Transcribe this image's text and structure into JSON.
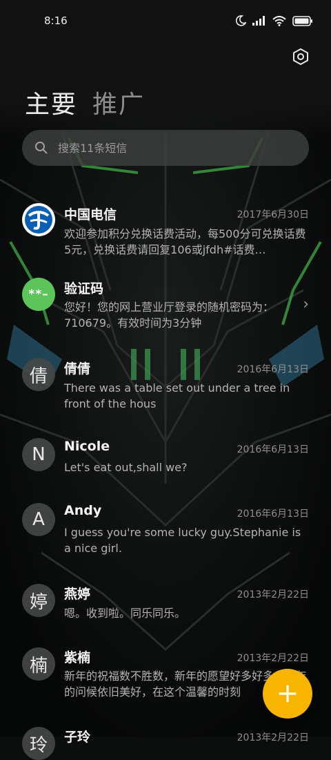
{
  "status_bar": {
    "time": "8:16"
  },
  "tabs": [
    {
      "label": "主要",
      "active": true
    },
    {
      "label": "推广",
      "active": false
    }
  ],
  "search": {
    "placeholder": "搜索11条短信"
  },
  "conversations": [
    {
      "name": "中国电信",
      "avatar_type": "telecom-logo",
      "date": "2017年6月30日",
      "preview": "欢迎参加积分兑换话费活动，每500分可兑换话费5元，兑换话费请回复106或jfdh#话费…"
    },
    {
      "name": "验证码",
      "avatar_text": "**–",
      "date": "",
      "preview": "您好！您的网上营业厅登录的随机密码为：710679。有效时间为3分钟"
    },
    {
      "name": "倩倩",
      "avatar_text": "倩",
      "date": "2016年6月13日",
      "preview": "There was a table set out under a tree in front of the hous"
    },
    {
      "name": "Nicole",
      "avatar_text": "N",
      "date": "2016年6月13日",
      "preview": "Let's eat out,shall we?"
    },
    {
      "name": "Andy",
      "avatar_text": "A",
      "date": "2016年6月13日",
      "preview": "I guess you're some lucky guy.Stephanie is a nice girl."
    },
    {
      "name": "燕婷",
      "avatar_text": "婷",
      "date": "2013年2月22日",
      "preview": "嗯。收到啦。同乐同乐。"
    },
    {
      "name": "紫楠",
      "avatar_text": "楠",
      "date": "2013年2月22日",
      "preview": "新年的祝福数不胜数，新年的愿望好多好多，新年的问候依旧美好，在这个温馨的时刻"
    },
    {
      "name": "子玲",
      "avatar_text": "玲",
      "date": "2013年2月22日",
      "preview": ""
    }
  ],
  "colors": {
    "accent_fab": "#f7b500",
    "code_avatar": "#5cc45a",
    "telecom_blue": "#0a5fb4"
  },
  "icons": {
    "settings": "hexagon-settings-icon",
    "search": "search-icon",
    "fab": "plus-icon",
    "chevron": "chevron-right-icon"
  }
}
